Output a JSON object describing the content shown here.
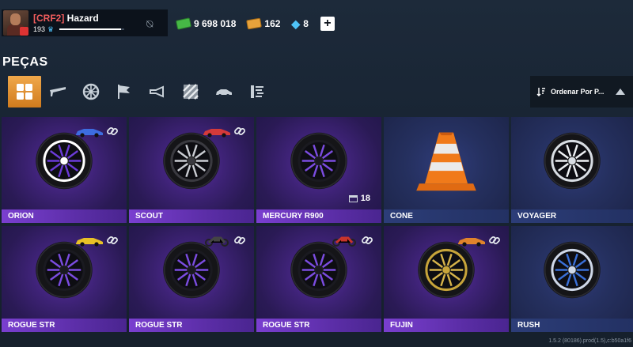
{
  "profile": {
    "clan_tag": "[CRF2]",
    "name": "Hazard",
    "level": "193",
    "xp_fraction": 0.95
  },
  "currencies": {
    "cash": "9 698 018",
    "gold": "162",
    "gems": "8"
  },
  "page_title": "PEÇAS",
  "filters": [
    "all-grid",
    "spoiler",
    "wheel",
    "flag",
    "horn",
    "pattern",
    "car-body",
    "suspension"
  ],
  "sort_label": "Ordenar Por P...",
  "cards": [
    {
      "name": "ORION",
      "kind": "wheel",
      "rim": "#ffffff",
      "spoke": "#6b3bd8",
      "linked": true,
      "car": "blue-car"
    },
    {
      "name": "SCOUT",
      "kind": "wheel",
      "rim": "#3a3a40",
      "spoke": "#c9ccd2",
      "linked": true,
      "car": "red-car"
    },
    {
      "name": "MERCURY R900",
      "kind": "wheel",
      "rim": "#1a1a20",
      "spoke": "#7b4ce0",
      "garage_count": "18"
    },
    {
      "name": "CONE",
      "kind": "cone"
    },
    {
      "name": "VOYAGER",
      "kind": "wheel",
      "rim": "#d8dde3",
      "spoke": "#eef1f4"
    },
    {
      "name": "ROGUE STR",
      "kind": "wheel",
      "rim": "#1a1a20",
      "spoke": "#7b4ce0",
      "linked": true,
      "car": "yellow-car"
    },
    {
      "name": "ROGUE STR",
      "kind": "wheel",
      "rim": "#1a1a20",
      "spoke": "#7b4ce0",
      "linked": true,
      "car": "motorcycle"
    },
    {
      "name": "ROGUE STR",
      "kind": "wheel",
      "rim": "#1a1a20",
      "spoke": "#7b4ce0",
      "linked": true,
      "car": "red-motorcycle"
    },
    {
      "name": "FUJIN",
      "kind": "wheel",
      "rim": "#c7a43a",
      "spoke": "#d6b34a",
      "linked": true,
      "car": "orange-car"
    },
    {
      "name": "RUSH",
      "kind": "wheel",
      "rim": "#cfd8e8",
      "spoke": "#3a70d8"
    }
  ],
  "version": "1.5.2 (80186).prod(1.5),c:b50a1f6"
}
